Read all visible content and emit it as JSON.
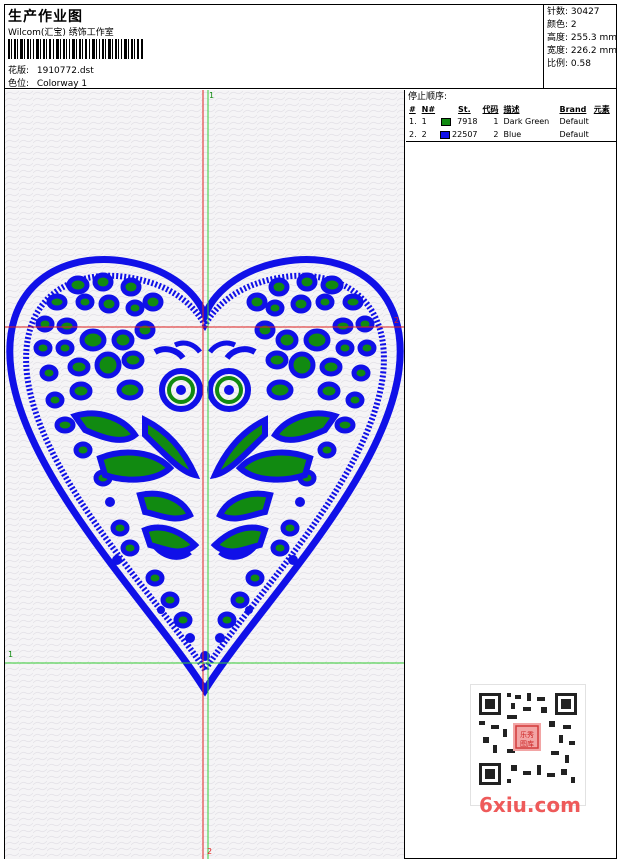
{
  "header": {
    "title": "生产作业图",
    "company": "Wilcom(汇宝) 绣饰工作室",
    "design_label": "花版:",
    "design_value": "1910772.dst",
    "colorway_label": "色位:",
    "colorway_value": "Colorway 1"
  },
  "stats": {
    "stitches": "针数: 30427",
    "colors": "颜色: 2",
    "height": "高度: 255.3 mm",
    "width": "宽度: 226.2 mm",
    "ratio": "比例: 0.58"
  },
  "stop_sequence": {
    "caption": "停止顺序:",
    "headers": [
      "#",
      "N#",
      "St.",
      "代码",
      "描述",
      "Brand",
      "元素"
    ],
    "rows": [
      {
        "idx": "1.",
        "n": "1",
        "color": "#118a11",
        "st": "7918",
        "code": "1",
        "desc": "Dark Green",
        "brand": "Default"
      },
      {
        "idx": "2.",
        "n": "2",
        "color": "#1010e8",
        "st": "22507",
        "code": "2",
        "desc": "Blue",
        "brand": "Default"
      }
    ]
  },
  "guides": {
    "top_v": "1",
    "bottom_v": "2",
    "left_h": "1",
    "right_h": "2"
  },
  "colors": {
    "blue": "#1010e8",
    "green": "#118a11",
    "guide_green": "#33cc33",
    "guide_red": "#e02020"
  },
  "watermark": "6xiu.com",
  "qr_seal": "乐秀图库"
}
